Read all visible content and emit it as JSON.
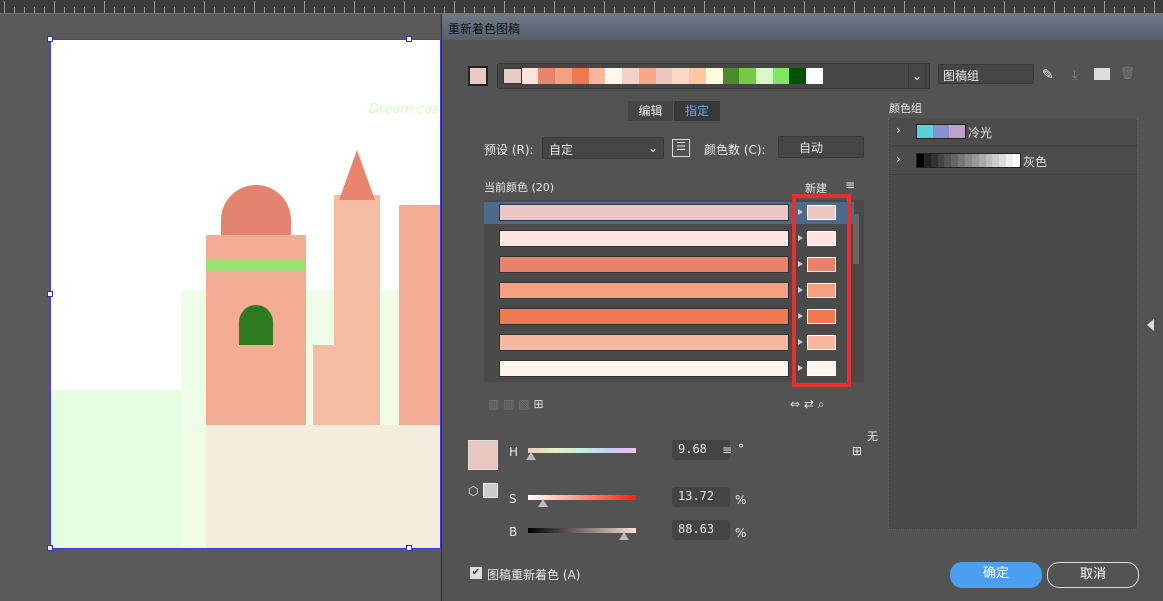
{
  "dialog": {
    "title": "重新着色图稿",
    "palette": [
      "#e8cbc5",
      "#fde2dc",
      "#e8846e",
      "#f6a082",
      "#f07850",
      "#f8b8a0",
      "#fff8ee",
      "#f5d0c8",
      "#f8a888",
      "#e8c8c0",
      "#fcd8c8",
      "#fcc8a0",
      "#fffce0",
      "#4a8a2a",
      "#78c848",
      "#d8f8c8",
      "#80e860",
      "#005000",
      "#ffffff"
    ],
    "artwork_group": "图稿组",
    "tabs": [
      {
        "label": "编辑"
      },
      {
        "label": "指定"
      }
    ],
    "preset_label": "预设 (R):",
    "preset_value": "自定",
    "colors_label": "颜色数 (C):",
    "colors_value": "自动",
    "current_colors": "当前颜色 (20)",
    "new_label": "新建",
    "rows": [
      {
        "current": "#e9c8c4",
        "new": "#e9c8c4"
      },
      {
        "current": "#fde4df",
        "new": "#fde4df"
      },
      {
        "current": "#e8826c",
        "new": "#e8826c"
      },
      {
        "current": "#f4a080",
        "new": "#f4a080"
      },
      {
        "current": "#f07a52",
        "new": "#f07a52"
      },
      {
        "current": "#f8b8a0",
        "new": "#f8b8a0"
      },
      {
        "current": "#fdf6ee",
        "new": "#fdf6ee"
      }
    ],
    "highlight_color": "#e53030",
    "hsb": {
      "h_label": "H",
      "h": "9.68",
      "h_unit": "°",
      "s_label": "S",
      "s": "13.72",
      "s_unit": "%",
      "b_label": "B",
      "b": "88.63",
      "b_unit": "%",
      "h_pct": 2.7,
      "s_pct": 13.72,
      "b_pct": 88.63
    },
    "none_label": "无",
    "color_groups_label": "颜色组",
    "groups": [
      {
        "name": "冷光",
        "colors": [
          "#5ad0d8",
          "#8890d0",
          "#c0a0d0"
        ]
      },
      {
        "name": "灰色",
        "colors": [
          "#000",
          "#222",
          "#333",
          "#444",
          "#555",
          "#666",
          "#777",
          "#888",
          "#999",
          "#aaa",
          "#bbb",
          "#ccc",
          "#ddd",
          "#eee",
          "#fff"
        ]
      }
    ],
    "recolor_checkbox": "图稿重新着色 (A)",
    "ok": "确定",
    "cancel": "取消"
  },
  "canvas": {
    "watermark": "Dream cas"
  }
}
